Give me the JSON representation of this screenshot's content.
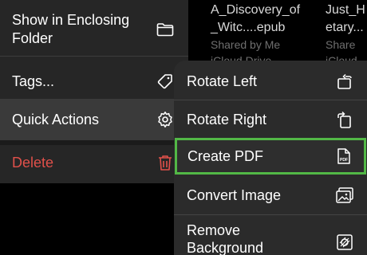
{
  "background_files": [
    {
      "name": "A_Discovery_of_Witc....epub",
      "line1": "A_Discovery_of",
      "line2": "_Witc....epub",
      "meta1": "Shared by Me",
      "meta2": "iCloud Drive"
    },
    {
      "line1": "Just_H",
      "line2": "etary...",
      "meta1": "Share",
      "meta2": "iCloud"
    }
  ],
  "context_menu": {
    "items": [
      {
        "label": "Show in Enclosing Folder",
        "icon": "folder-icon"
      },
      {
        "label": "Tags...",
        "icon": "tag-icon"
      },
      {
        "label": "Quick Actions",
        "icon": "gear-icon"
      },
      {
        "label": "Delete",
        "icon": "trash-icon"
      }
    ]
  },
  "quick_actions_submenu": {
    "items": [
      {
        "label": "Rotate Left",
        "icon": "rotate-left-icon"
      },
      {
        "label": "Rotate Right",
        "icon": "rotate-right-icon"
      },
      {
        "label": "Create PDF",
        "icon": "pdf-icon",
        "icon_text": "PDF",
        "highlighted": true
      },
      {
        "label": "Convert Image",
        "icon": "photos-icon"
      },
      {
        "label": "Remove Background",
        "icon": "remove-background-icon"
      }
    ]
  },
  "colors": {
    "highlight": "#52b846",
    "delete": "#e0504a",
    "menu_bg": "#262626"
  }
}
